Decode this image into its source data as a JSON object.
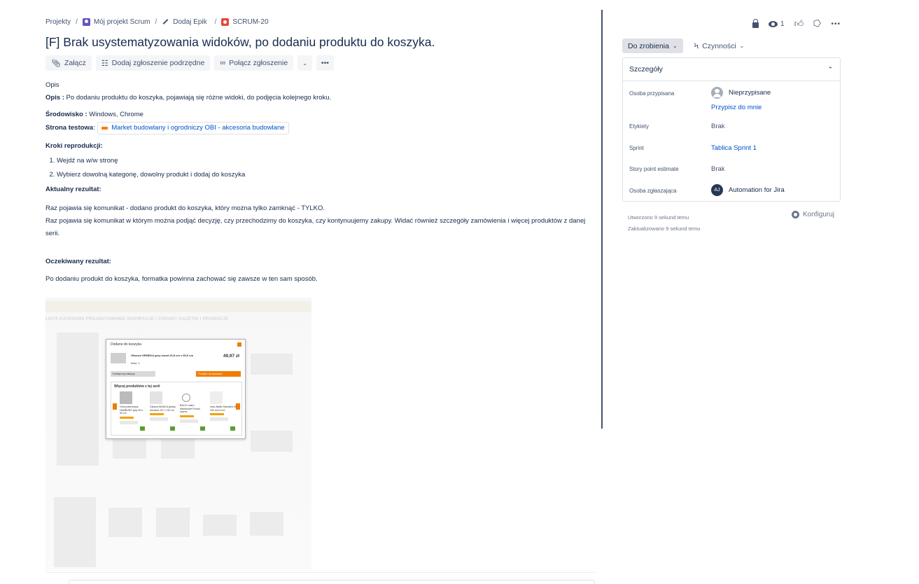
{
  "breadcrumb": {
    "projects": "Projekty",
    "project": "Mój projekt Scrum",
    "epic": "Dodaj Epik",
    "issue_key": "SCRUM-20"
  },
  "issue": {
    "title": "[F] Brak usystematyzowania widoków, po dodaniu produktu do koszyka."
  },
  "toolbar": {
    "attach": "Załącz",
    "add_child": "Dodaj zgłoszenie podrzędne",
    "link_issue": "Połącz zgłoszenie",
    "dropdown_icon": "chevron-down-icon",
    "more": "•••"
  },
  "description": {
    "heading": "Opis",
    "opis_label": "Opis :",
    "opis_text": " Po dodaniu produktu do koszyka, pojawiają się różne widoki, do podjęcia kolejnego kroku.",
    "env_label": "Środowisko :",
    "env_text": " Windows, Chrome",
    "site_label": "Strona testowa",
    "site_colon": ": ",
    "site_link": "Market budowlany i ogrodniczy OBI - akcesoria budowlane",
    "steps_heading": "Kroki reprodukcji:",
    "steps": [
      "Wejdź na w/w stronę",
      "Wybierz dowolną kategorię, dowolny produkt i dodaj do koszyka"
    ],
    "actual_heading": "Aktualny rezultat:",
    "actual_line1": "Raz pojawia się komunikat - dodano produkt do koszyka, który można tylko zamknąć - TYLKO.",
    "actual_line2": "Raz pojawia się komunikat w którym można podjąć decyzję, czy przechodzimy do koszyka, czy kontynuujemy zakupy. Widać również szczegóły zamówienia i więcej produktów z danej serii.",
    "expected_heading": "Oczekiwany rezultat:",
    "expected_text": "Po dodaniu produkt do koszyka, formatka powinna zachować się zawsze  w ten sam sposób."
  },
  "attachment": {
    "nav": "LISTA KATEGORII   PROJEKTOWANIE   INSPIRACJE I PORADY   GAZETKI I PROMOCJE",
    "modal_title": "Dodano do koszyka",
    "product_name": "Glazura ORNEKA grey wood 20,8 cm x 65,9 cm",
    "qty": "Ilość: 1",
    "price": "49,97 zł",
    "continue": "Kontynuuj zakupy",
    "go_to_cart": "Przejdź do koszyka",
    "related_title": "Więcej produktów z tej serii",
    "related": [
      "Gres polerowany HAMBURG grey 60 x 60 cm",
      "Glazura BIANCA glossy structure 29,7 x 60 cm",
      "BALIV Lustro łazienkowe Round czarne",
      "Uwa Walke Standard 45 150 mm 5 m2"
    ]
  },
  "sidebar": {
    "watch_count": "1",
    "icons": [
      "lock-icon",
      "eye-icon",
      "thumbs-up-icon",
      "share-icon",
      "more-icon"
    ],
    "status": "Do zrobienia",
    "actions": "Czynności",
    "details_title": "Szczegóły",
    "fields": {
      "assignee_label": "Osoba przypisana",
      "assignee_value": "Nieprzypisane",
      "assign_to_me": "Przypisz do mnie",
      "labels_label": "Etykiety",
      "labels_value": "Brak",
      "sprint_label": "Sprint",
      "sprint_value": "Tablica Sprint 1",
      "story_points_label": "Story point estimate",
      "story_points_value": "Brak",
      "reporter_label": "Osoba zgłaszająca",
      "reporter_initials": "AJ",
      "reporter_value": "Automation for Jira"
    },
    "created": "Utworzono 9 sekund temu",
    "updated": "Zaktualizowano 9 sekund temu",
    "configure": "Konfiguruj"
  },
  "colors": {
    "link": "#0052cc",
    "text": "#172b4d",
    "bug": "#e5493a",
    "divider": "#42526e"
  }
}
